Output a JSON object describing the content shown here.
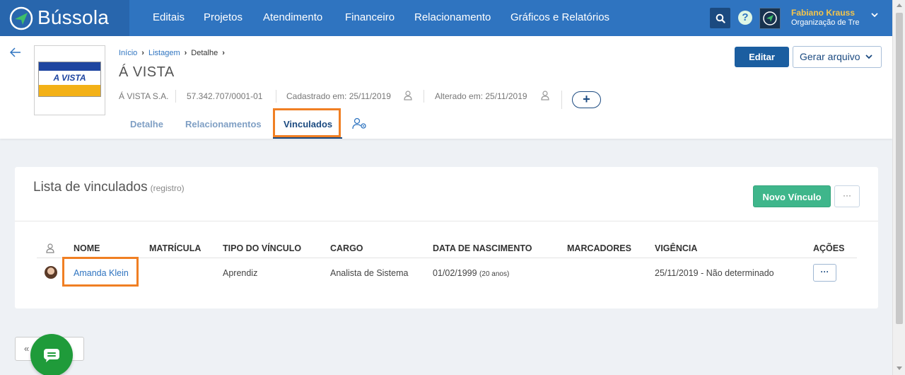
{
  "app": {
    "brand_name": "Bússola"
  },
  "nav": {
    "items": [
      {
        "label": "Editais"
      },
      {
        "label": "Projetos"
      },
      {
        "label": "Atendimento"
      },
      {
        "label": "Financeiro"
      },
      {
        "label": "Relacionamento"
      },
      {
        "label": "Gráficos e Relatórios"
      }
    ],
    "help_label": "?"
  },
  "user": {
    "name": "Fabiano Krauss",
    "org": "Organização de Tre"
  },
  "breadcrumb": {
    "home": "Início",
    "list": "Listagem",
    "current": "Detalhe"
  },
  "entity": {
    "title": "Á VISTA",
    "logo_text": "A VISTA",
    "short_name": "Á VISTA S.A.",
    "cnpj": "57.342.707/0001-01",
    "created": "Cadastrado em: 25/11/2019",
    "updated": "Alterado em: 25/11/2019"
  },
  "actions": {
    "edit_label": "Editar",
    "generate_label": "Gerar arquivo",
    "add_label": "+"
  },
  "tabs": [
    {
      "label": "Detalhe"
    },
    {
      "label": "Relacionamentos"
    },
    {
      "label": "Vinculados"
    }
  ],
  "card": {
    "title": "Lista de vinculados",
    "subtitle": "(registro)",
    "new_button": "Novo Vínculo",
    "more_label": "···"
  },
  "table": {
    "headers": {
      "name": "NOME",
      "matricula": "MATRÍCULA",
      "tipo": "TIPO DO VÍNCULO",
      "cargo": "CARGO",
      "nascimento": "DATA DE NASCIMENTO",
      "marcadores": "MARCADORES",
      "vigencia": "VIGÊNCIA",
      "acoes": "AÇÕES"
    },
    "rows": [
      {
        "name": "Amanda Klein",
        "matricula": "",
        "tipo": "Aprendiz",
        "cargo": "Analista de Sistema",
        "nascimento": "01/02/1999",
        "idade": "(20 anos)",
        "marcadores": "",
        "vigencia": "25/11/2019 - Não determinado",
        "acoes": "···"
      }
    ]
  },
  "pager": {
    "first": "«"
  },
  "colors": {
    "nav_bg": "#2f74c0",
    "primary": "#1b5ea0",
    "success": "#3fb68b",
    "highlight": "#f07f23",
    "chat": "#1f9b3a"
  }
}
